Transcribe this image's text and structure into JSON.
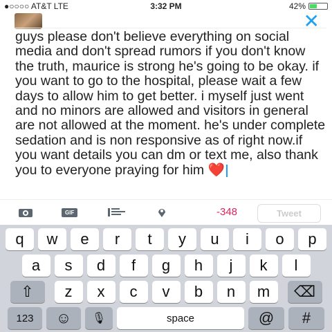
{
  "status": {
    "carrier": "●○○○○ AT&T  LTE",
    "time": "3:32 PM",
    "battery": "42%",
    "battery_level": 0.42
  },
  "header": {
    "close": "✕"
  },
  "compose": {
    "text": "guys please don't believe everything on social media and don't spread rumors if you don't know the truth, maurice is strong he's going to be okay. if you want to go to the hospital, please wait a few days to allow him to get better. i myself just went and no minors are allowed and visitors in general are not allowed at the moment. he's under complete sedation and is non responsive as of right now.if you want details you can dm or text me, also thank you to everyone praying for him",
    "emoji": "❤️"
  },
  "toolbar": {
    "gif": "GIF",
    "count": "-348",
    "tweet": "Tweet"
  },
  "keyboard": {
    "row1": [
      "q",
      "w",
      "e",
      "r",
      "t",
      "y",
      "u",
      "i",
      "o",
      "p"
    ],
    "row2": [
      "a",
      "s",
      "d",
      "f",
      "g",
      "h",
      "j",
      "k",
      "l"
    ],
    "row3": [
      "z",
      "x",
      "c",
      "v",
      "b",
      "n",
      "m"
    ],
    "shift": "⇧",
    "delete": "⌫",
    "numbers": "123",
    "emoji": "☺",
    "mic": "🎙",
    "space": "space",
    "at": "@",
    "hash": "#"
  }
}
